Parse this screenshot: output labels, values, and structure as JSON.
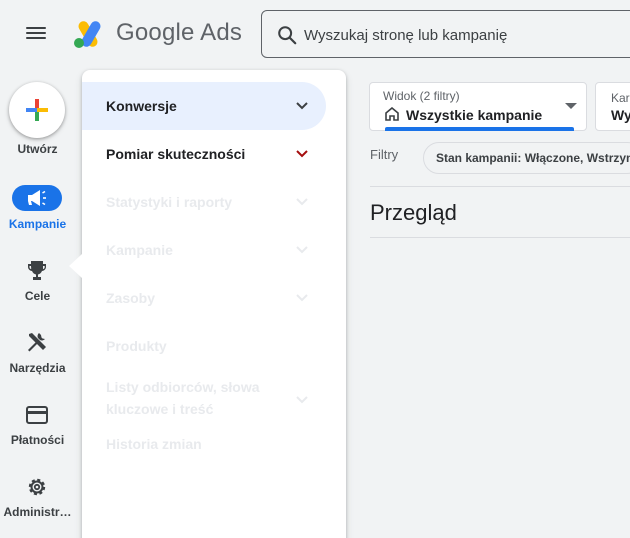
{
  "app": {
    "title": "Google Ads"
  },
  "search": {
    "placeholder": "Wyszukaj stronę lub kampanię"
  },
  "rail": {
    "items": [
      {
        "label": "Utwórz",
        "icon": "plus-icon"
      },
      {
        "label": "Kampanie",
        "icon": "megaphone-icon",
        "active": true
      },
      {
        "label": "Cele",
        "icon": "trophy-icon"
      },
      {
        "label": "Narzędzia",
        "icon": "tools-icon"
      },
      {
        "label": "Płatności",
        "icon": "credit-card-icon"
      },
      {
        "label": "Administr…",
        "icon": "gear-icon"
      }
    ]
  },
  "menu": {
    "items": [
      {
        "label": "Konwersje",
        "active": true,
        "enabled": true
      },
      {
        "label": "Pomiar skuteczności",
        "enabled": true
      },
      {
        "label": "Statystyki i raporty",
        "enabled": false
      },
      {
        "label": "Kampanie",
        "enabled": false
      },
      {
        "label": "Zasoby",
        "enabled": false
      },
      {
        "label": "Produkty",
        "enabled": false
      },
      {
        "label": "Listy odbiorców, słowa kluczowe i treść",
        "enabled": false
      },
      {
        "label": "Historia zmian",
        "enabled": false
      }
    ]
  },
  "view": {
    "caption": "Widok (2 filtry)",
    "value": "Wszystkie kampanie",
    "second_caption": "Kar",
    "second_value": "Wy"
  },
  "filters": {
    "label": "Filtry",
    "chip": "Stan kampanii: Włączone, Wstrzymane"
  },
  "main": {
    "heading": "Przegląd"
  },
  "colors": {
    "accent": "#1a73e8",
    "background": "#f1f3f4",
    "active_menu": "#e8f0fe"
  }
}
